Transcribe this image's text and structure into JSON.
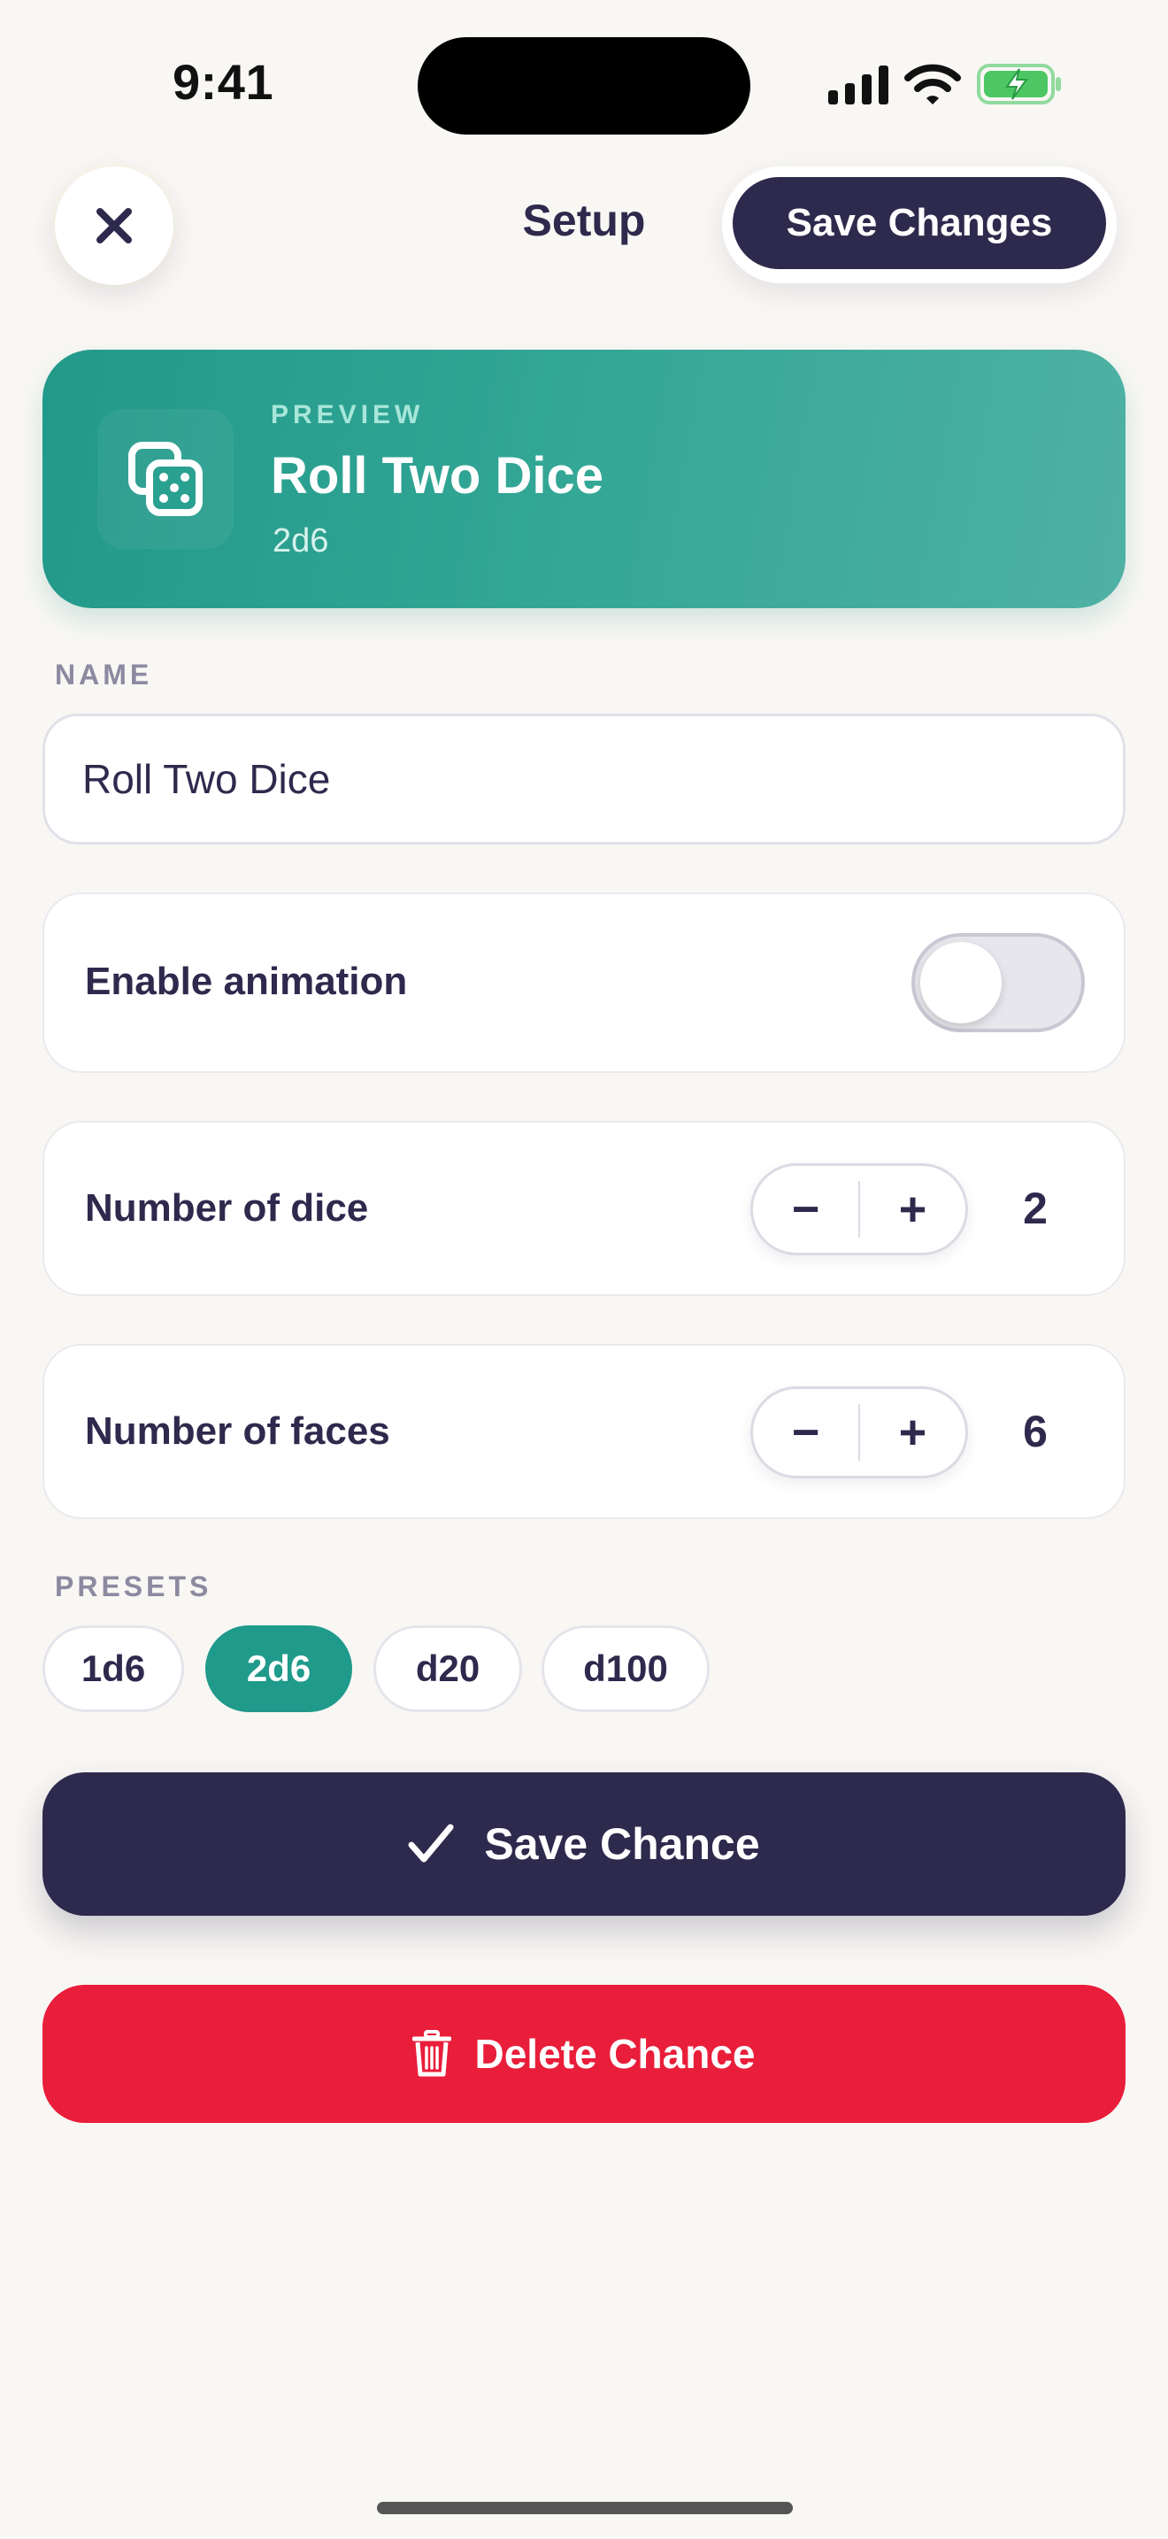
{
  "status_bar": {
    "time": "9:41"
  },
  "header": {
    "title": "Setup",
    "save_label": "Save Changes"
  },
  "preview": {
    "eyebrow": "PREVIEW",
    "title": "Roll Two Dice",
    "subtitle": "2d6",
    "icon": "dice-icon"
  },
  "name_section": {
    "label": "NAME",
    "value": "Roll Two Dice"
  },
  "animation": {
    "label": "Enable animation",
    "enabled": false
  },
  "dice_count": {
    "label": "Number of dice",
    "value": "2",
    "minus": "−",
    "plus": "+"
  },
  "faces_count": {
    "label": "Number of faces",
    "value": "6",
    "minus": "−",
    "plus": "+"
  },
  "presets": {
    "label": "PRESETS",
    "items": [
      {
        "label": "1d6",
        "active": false
      },
      {
        "label": "2d6",
        "active": true
      },
      {
        "label": "d20",
        "active": false
      },
      {
        "label": "d100",
        "active": false
      }
    ]
  },
  "actions": {
    "save": "Save Chance",
    "delete": "Delete Chance"
  },
  "colors": {
    "accent": "#1f9a8b",
    "primary": "#2e2a4d",
    "danger": "#e91e3a",
    "background": "#f9f7f4"
  }
}
